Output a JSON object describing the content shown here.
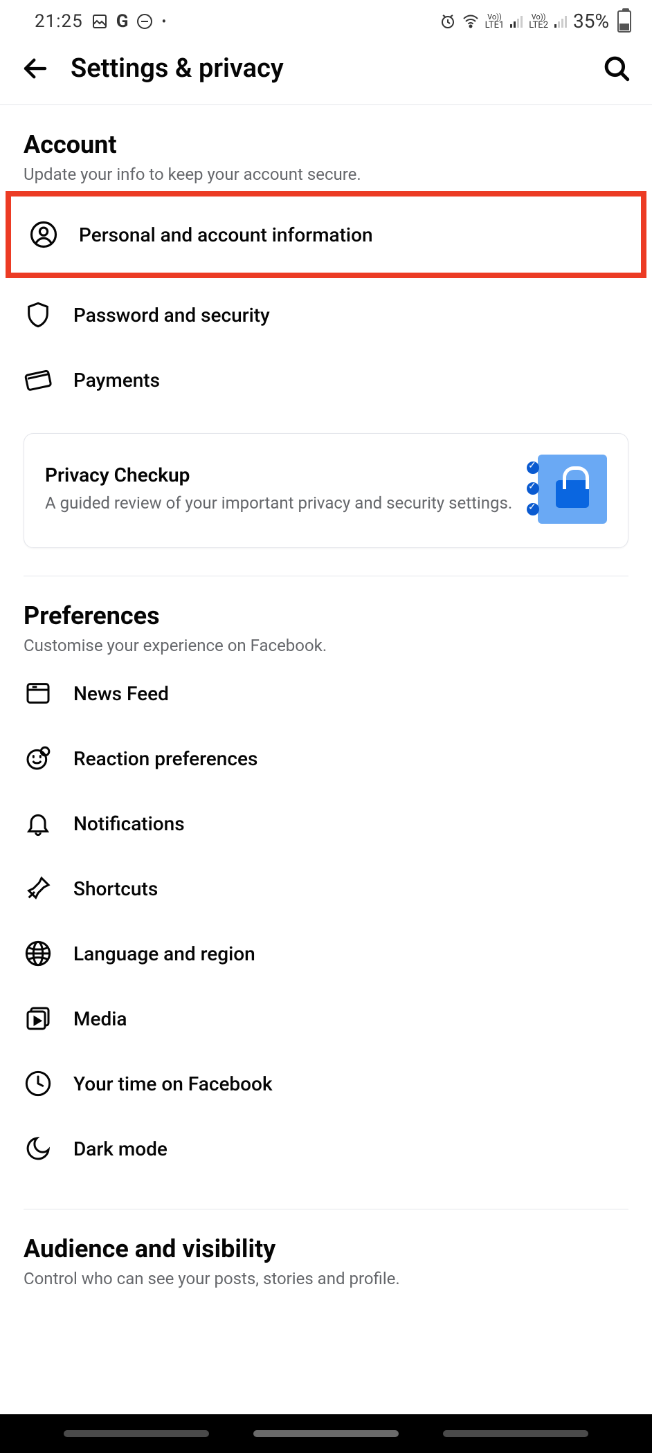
{
  "status": {
    "time": "21:25",
    "lte1": "LTE1",
    "lte2": "LTE2",
    "battery_pct": "35%"
  },
  "header": {
    "title": "Settings & privacy"
  },
  "sections": {
    "account": {
      "title": "Account",
      "sub": "Update your info to keep your account secure.",
      "items": {
        "personal": "Personal and account information",
        "password": "Password and security",
        "payments": "Payments"
      }
    },
    "privacy_card": {
      "title": "Privacy Checkup",
      "sub": "A guided review of your important privacy and security settings."
    },
    "preferences": {
      "title": "Preferences",
      "sub": "Customise your experience on Facebook.",
      "items": {
        "newsfeed": "News Feed",
        "reaction": "Reaction preferences",
        "notifications": "Notifications",
        "shortcuts": "Shortcuts",
        "language": "Language and region",
        "media": "Media",
        "yourtime": "Your time on Facebook",
        "darkmode": "Dark mode"
      }
    },
    "audience": {
      "title": "Audience and visibility",
      "sub": "Control who can see your posts, stories and profile."
    }
  },
  "highlight": {
    "color": "#ec3b24",
    "target": "personal"
  }
}
